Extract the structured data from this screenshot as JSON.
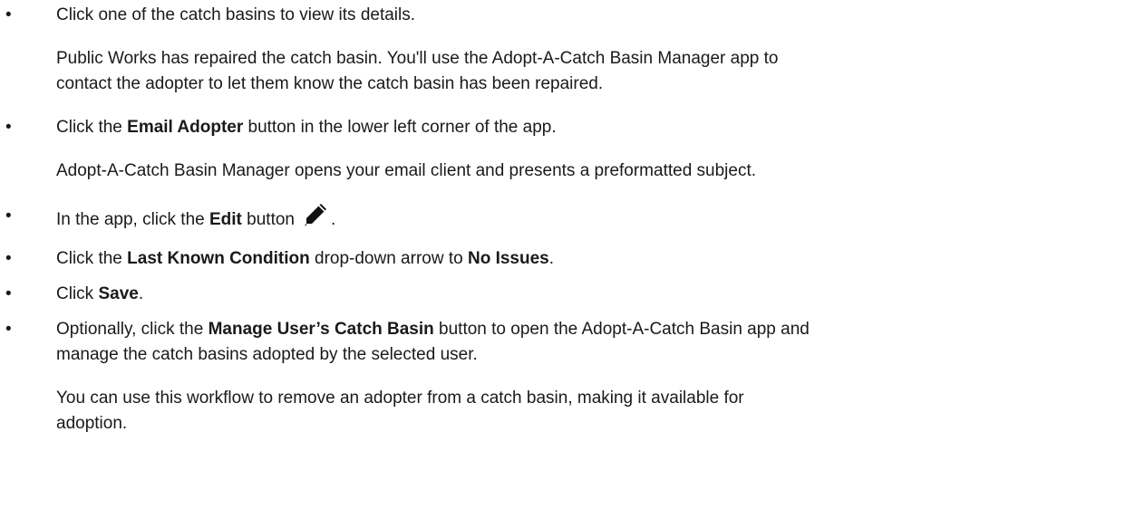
{
  "steps": [
    {
      "text": "Click one of the catch basins to view its details."
    },
    {
      "note_line1": "Public Works has repaired the catch basin. You'll use the Adopt-A-Catch Basin Manager app to",
      "note_line2": "contact the adopter to let them know the catch basin has been repaired."
    },
    {
      "pre": "Click the ",
      "bold": "Email Adopter",
      "post": " button in the lower left corner of the app.",
      "note": "Adopt-A-Catch Basin Manager opens your email client and presents a preformatted subject."
    },
    {
      "pre": "In the app, click the ",
      "bold": "Edit",
      "post": " button",
      "after_icon": ".",
      "icon": "pencil-icon"
    },
    {
      "pre": " Click the ",
      "bold": "Last Known Condition",
      "mid": " drop-down arrow to ",
      "bold2": "No Issues",
      "post": "."
    },
    {
      "pre": "Click ",
      "bold": "Save",
      "post": "."
    },
    {
      "pre": "Optionally, click the ",
      "bold": "Manage User’s Catch Basin",
      "post": " button to open the Adopt-A-Catch Basin app and",
      "line2": "manage the catch basins adopted by the selected user.",
      "note_line1": "You can use this workflow to remove an adopter from a catch basin, making it available for",
      "note_line2": "adoption."
    }
  ],
  "bullet_char": "•"
}
